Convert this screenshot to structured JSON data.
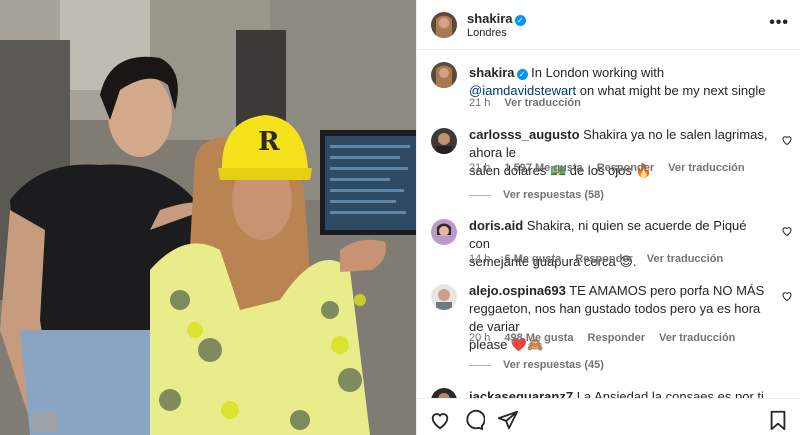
{
  "post": {
    "author": "shakira",
    "location": "Londres",
    "more_label": "•••"
  },
  "caption": {
    "author": "shakira",
    "text_before": "In London working with ",
    "mention": "@iamdavidstewart",
    "text_after": " on what might be my next single",
    "time": "21 h",
    "translate": "Ver traducción"
  },
  "comments": [
    {
      "user": "carlosss_augusto",
      "text_line1": "Shakira ya no le salen lagrimas, ahora le",
      "text_line2": "salen dólares 💵 de los ojos 🔥",
      "time": "21 h",
      "likes": "1,597 Me gusta",
      "reply": "Responder",
      "translate": "Ver traducción",
      "replies": "Ver respuestas (58)"
    },
    {
      "user": "doris.aid",
      "text_line1": "Shakira, ni quien se acuerde de Piqué con",
      "text_line2": "semejante guapura cerca 😍.",
      "time": "14 h",
      "likes": "6 Me gusta",
      "reply": "Responder",
      "translate": "Ver traducción"
    },
    {
      "user": "alejo.ospina693",
      "text_line1": "TE AMAMOS pero porfa NO MÁS",
      "text_line2": "reggaeton, nos han gustado todos pero ya es hora de variar",
      "text_line3": "please ❤️🙈",
      "time": "20 h",
      "likes": "498 Me gusta",
      "reply": "Responder",
      "translate": "Ver traducción",
      "replies": "Ver respuestas (45)"
    },
    {
      "user": "jackasequaranz7",
      "text_line1": "La Ansiedad la consaes es por ti 😅"
    }
  ],
  "colors": {
    "verified": "#0095f6",
    "muted": "#737373",
    "mention": "#00376b",
    "cap_yellow": "#f6e21a"
  }
}
